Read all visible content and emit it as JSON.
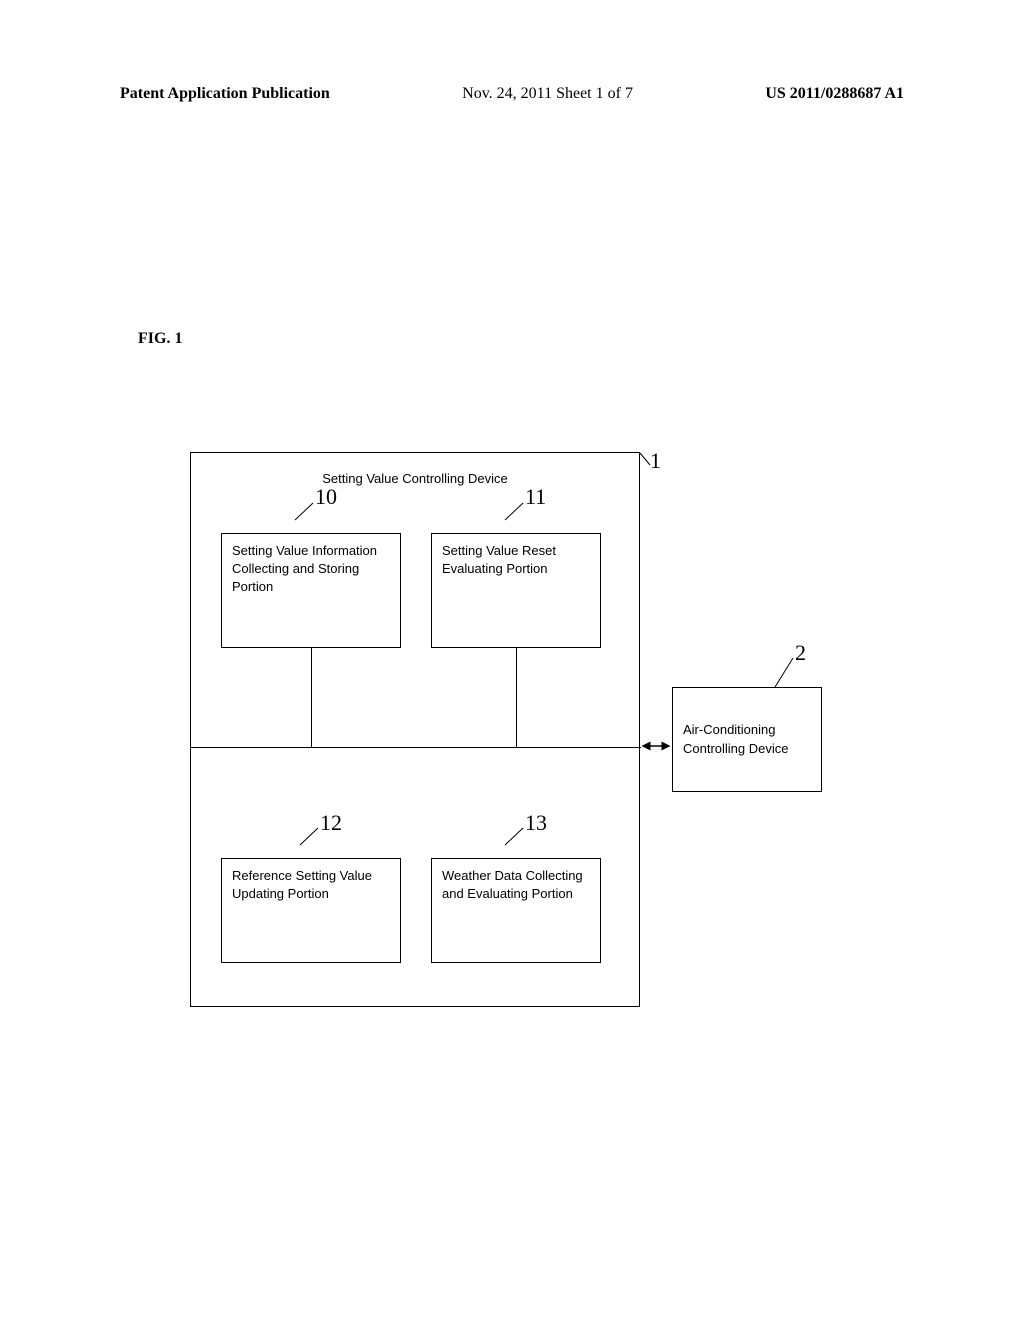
{
  "header": {
    "left": "Patent Application Publication",
    "center": "Nov. 24, 2011  Sheet 1 of 7",
    "right": "US 2011/0288687 A1"
  },
  "figure_label": "FIG. 1",
  "main_device": {
    "title": "Setting Value Controlling Device",
    "ref": "1"
  },
  "boxes": {
    "box10": {
      "ref": "10",
      "text": "Setting Value Information Collecting and Storing Portion"
    },
    "box11": {
      "ref": "11",
      "text": "Setting Value Reset Evaluating Portion"
    },
    "box12": {
      "ref": "12",
      "text": "Reference Setting Value Updating Portion"
    },
    "box13": {
      "ref": "13",
      "text": "Weather Data Collecting and Evaluating Portion"
    }
  },
  "external_box": {
    "ref": "2",
    "text": "Air-Conditioning Controlling Device"
  }
}
